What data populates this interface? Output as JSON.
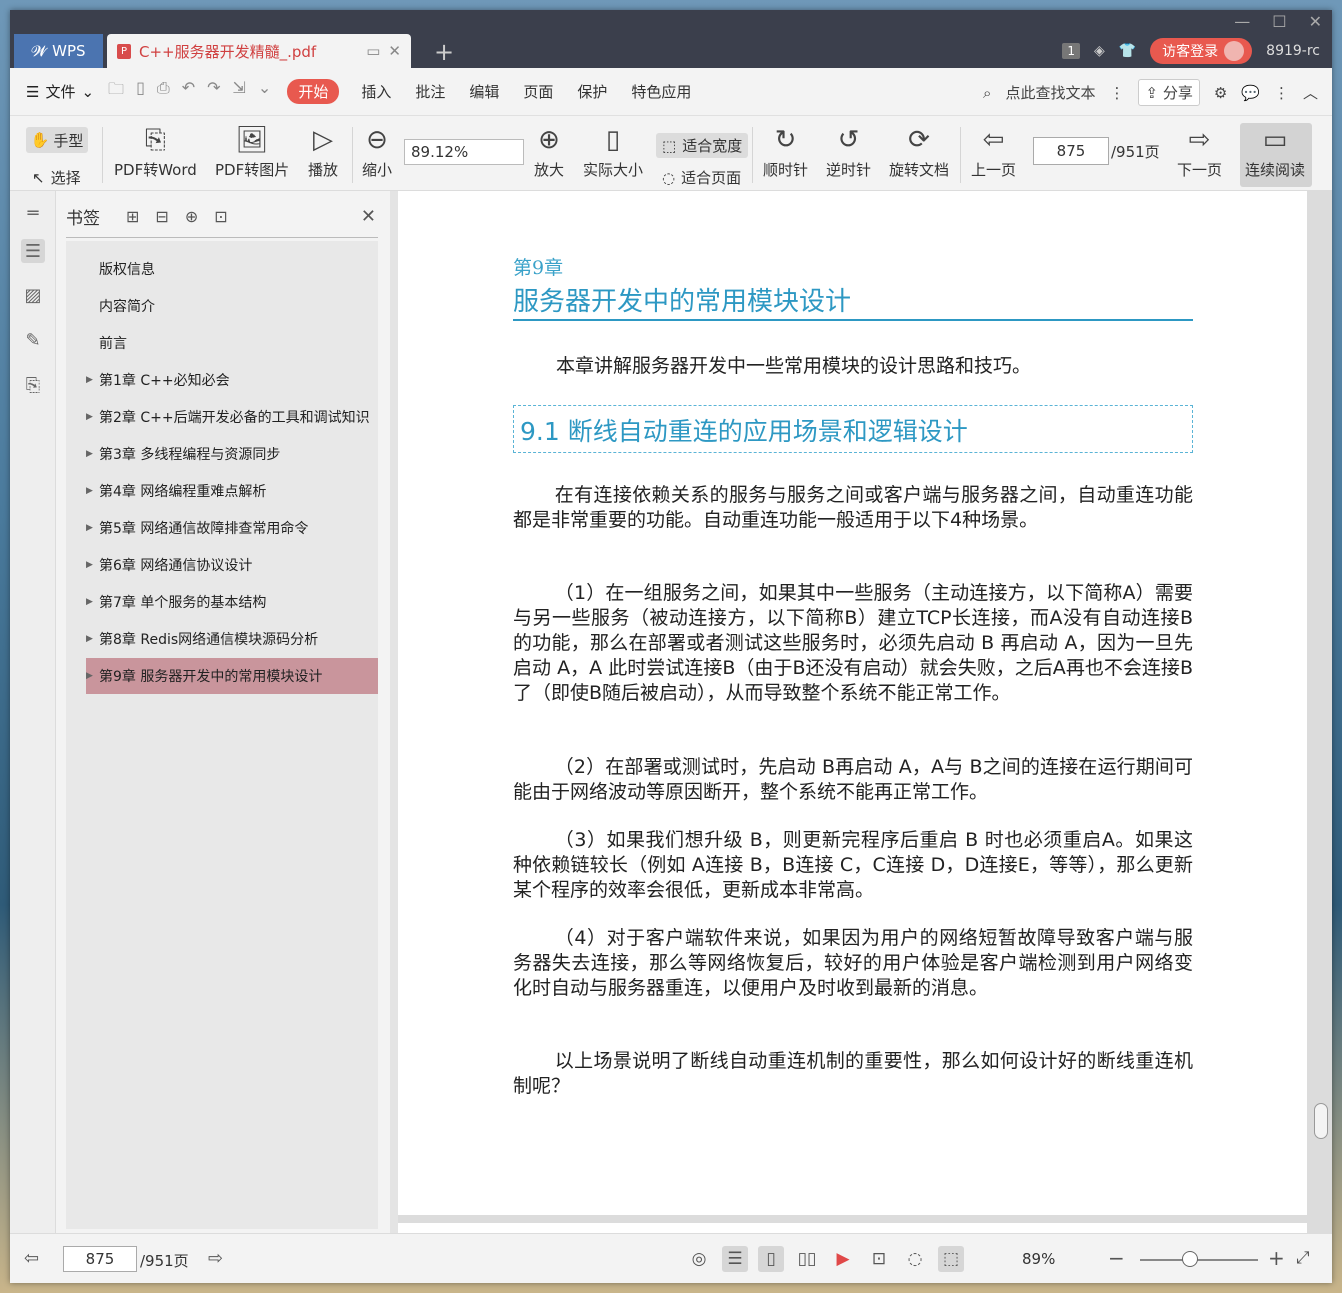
{
  "titlebar": {
    "app_tab": "WPS",
    "doc_tab": "C++服务器开发精髓_.pdf",
    "badge_count": "1",
    "login_label": "访客登录",
    "user_label": "8919-rc"
  },
  "menu": {
    "file": "文件",
    "items": [
      "开始",
      "插入",
      "批注",
      "编辑",
      "页面",
      "保护",
      "特色应用"
    ],
    "search": "点此查找文本",
    "share": "分享"
  },
  "ribbon": {
    "hand": "手型",
    "select": "选择",
    "pdf_to_word": "PDF转Word",
    "pdf_to_image": "PDF转图片",
    "play": "播放",
    "zoom_out": "缩小",
    "zoom_value": "89.12%",
    "zoom_in": "放大",
    "actual_size": "实际大小",
    "fit_width": "适合宽度",
    "fit_page": "适合页面",
    "rotate_cw": "顺时针",
    "rotate_ccw": "逆时针",
    "rotate_doc": "旋转文档",
    "prev_page": "上一页",
    "current_page": "875",
    "total_pages": "/951页",
    "next_page": "下一页",
    "continuous": "连续阅读"
  },
  "bookmarks": {
    "title": "书签",
    "items": [
      "版权信息",
      "内容简介",
      "前言",
      "第1章 C++必知必会",
      "第2章 C++后端开发必备的工具和调试知识",
      "第3章 多线程编程与资源同步",
      "第4章 网络编程重难点解析",
      "第5章 网络通信故障排查常用命令",
      "第6章 网络通信协议设计",
      "第7章 单个服务的基本结构",
      "第8章 Redis网络通信模块源码分析",
      "第9章 服务器开发中的常用模块设计"
    ]
  },
  "document": {
    "chapter_num": "第9章",
    "chapter_title": "服务器开发中的常用模块设计",
    "intro": "本章讲解服务器开发中一些常用模块的设计思路和技巧。",
    "section_title": "9.1 断线自动重连的应用场景和逻辑设计",
    "paragraphs": [
      "在有连接依赖关系的服务与服务之间或客户端与服务器之间，自动重连功能都是非常重要的功能。自动重连功能一般适用于以下4种场景。",
      "（1）在一组服务之间，如果其中一些服务（主动连接方，以下简称A）需要与另一些服务（被动连接方，以下简称B）建立TCP长连接，而A没有自动连接B的功能，那么在部署或者测试这些服务时，必须先启动 B 再启动 A，因为一旦先启动 A，A 此时尝试连接B（由于B还没有启动）就会失败，之后A再也不会连接B了（即使B随后被启动），从而导致整个系统不能正常工作。",
      "（2）在部署或测试时，先启动 B再启动 A，A与 B之间的连接在运行期间可能由于网络波动等原因断开，整个系统不能再正常工作。",
      "（3）如果我们想升级 B，则更新完程序后重启 B 时也必须重启A。如果这种依赖链较长（例如 A连接 B，B连接 C，C连接 D，D连接E，等等），那么更新某个程序的效率会很低，更新成本非常高。",
      "（4）对于客户端软件来说，如果因为用户的网络短暂故障导致客户端与服务器失去连接，那么等网络恢复后，较好的用户体验是客户端检测到用户网络变化时自动与服务器重连，以便用户及时收到最新的消息。",
      "以上场景说明了断线自动重连机制的重要性，那么如何设计好的断线重连机制呢？"
    ]
  },
  "statusbar": {
    "page": "875",
    "total": "/951页",
    "zoom": "89%"
  }
}
